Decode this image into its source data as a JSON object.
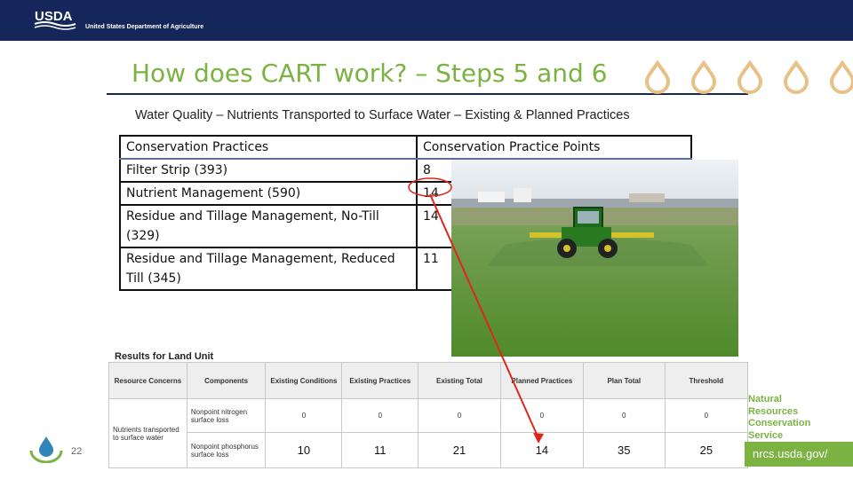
{
  "header": {
    "logo_text": "USDA",
    "org_name": "United States Department of Agriculture"
  },
  "slide": {
    "title": "How does CART work? – Steps 5 and 6",
    "subtitle": "Water Quality – Nutrients Transported to Surface Water – Existing & Planned  Practices",
    "page_number": "22"
  },
  "practices_table": {
    "headers": [
      "Conservation Practices",
      "Conservation Practice Points"
    ],
    "rows": [
      {
        "practice": "Filter Strip (393)",
        "points": "8"
      },
      {
        "practice": "Nutrient Management (590)",
        "points": "14"
      },
      {
        "practice": "Residue and Tillage Management, No-Till (329)",
        "points": "14"
      },
      {
        "practice": "Residue and Tillage Management, Reduced Till (345)",
        "points": "11"
      }
    ]
  },
  "results": {
    "label": "Results for Land Unit",
    "headers": [
      "Resource Concerns",
      "Components",
      "Existing Conditions",
      "Existing Practices",
      "Existing Total",
      "Planned Practices",
      "Plan Total",
      "Threshold"
    ],
    "concern": "Nutrients transported to surface water",
    "rows": [
      {
        "component": "Nonpoint nitrogen surface loss",
        "existing_conditions": "0",
        "existing_practices": "0",
        "existing_total": "0",
        "planned_practices": "0",
        "plan_total": "0",
        "threshold": "0"
      },
      {
        "component": "Nonpoint phosphorus surface loss",
        "existing_conditions": "10",
        "existing_practices": "11",
        "existing_total": "21",
        "planned_practices": "14",
        "plan_total": "35",
        "threshold": "25"
      }
    ]
  },
  "footer": {
    "agency_line1": "Natural",
    "agency_line2": "Resources",
    "agency_line3": "Conservation",
    "agency_line4": "Service",
    "url": "nrcs.usda.gov/"
  },
  "colors": {
    "navy": "#15275a",
    "green": "#7ab342",
    "arrow": "#e0261b"
  }
}
